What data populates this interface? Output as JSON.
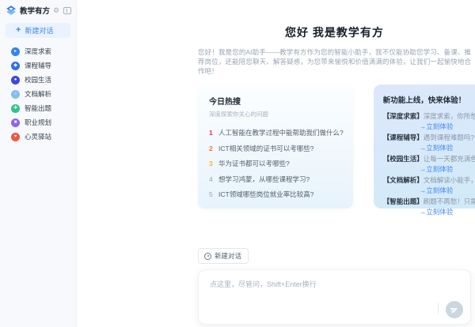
{
  "app": {
    "name": "教学有方"
  },
  "colors": {
    "accent": "#3f87f6",
    "link": "#3d86f5",
    "rank_colors": [
      "#fe2c46",
      "#ff6f2c",
      "#ffb02c",
      "#9aa3af",
      "#9aa3af"
    ],
    "sidebar_icon_colors": [
      "#3583f2",
      "#2f6ef0",
      "#4246d6",
      "#85bdf2",
      "#2ec48b",
      "#8b66f0",
      "#f25540"
    ],
    "hot_card_bg": "#e7f3fb",
    "feature_card_bg": "#d5e9f9",
    "send_button_bg": "#ccd6de"
  },
  "sidebar": {
    "title": "教学有方",
    "logo_icon": "layered-diamond-icon",
    "gear_glyph": "⚙",
    "new_chat": {
      "label": "新建对话",
      "plus": "+"
    },
    "items": [
      {
        "label": "深度求索",
        "icon": "deep-explore-icon",
        "color": "#3583f2",
        "glyph": "▸"
      },
      {
        "label": "课程辅导",
        "icon": "course-tutoring-icon",
        "color": "#2f6ef0",
        "glyph": "◆"
      },
      {
        "label": "校园生活",
        "icon": "campus-life-icon",
        "color": "#4246d6",
        "glyph": "●"
      },
      {
        "label": "文档解析",
        "icon": "doc-analysis-icon",
        "color": "#85bdf2",
        "glyph": "○"
      },
      {
        "label": "智能出题",
        "icon": "quiz-generator-icon",
        "color": "#2ec48b",
        "glyph": "✚"
      },
      {
        "label": "职业规划",
        "icon": "career-planning-icon",
        "color": "#8b66f0",
        "glyph": "■"
      },
      {
        "label": "心灵驿站",
        "icon": "mind-station-icon",
        "color": "#f25540",
        "glyph": "♥"
      }
    ]
  },
  "main": {
    "greeting_title": "您好 我是教学有方",
    "greeting_text": "您好！我是您的AI助手——教学有方作为您的智能小助手，我不仅能协助您学习、备课、推荐岗位，还能陪您聊天、解答疑惑，为您带来愉悦和价值满满的体验，让我们一起愉快地合作吧！",
    "hot_card": {
      "title": "今日热搜",
      "subtitle": "深度探索你关心的问题",
      "items": [
        {
          "rank": "1",
          "text": "人工智能在教学过程中能帮助我们做什么?"
        },
        {
          "rank": "2",
          "text": "ICT相关领域的证书可以考哪些?"
        },
        {
          "rank": "3",
          "text": "华为证书都可以考哪些?"
        },
        {
          "rank": "4",
          "text": "想学习鸿蒙，从哪些课程学习?"
        },
        {
          "rank": "5",
          "text": "ICT领域哪些岗位就业率比较高?"
        }
      ]
    },
    "feature_card": {
      "title": "新功能上线，快来体验！",
      "link_label": "→立刻体验",
      "items": [
        {
          "tag": "【深度求索】",
          "text": "深度求索，你所想要"
        },
        {
          "tag": "【课程辅导】",
          "text": "遇到课程难题吗? 别急，我在..."
        },
        {
          "tag": "【校园生活】",
          "text": "让每一天都充满色彩，让每一..."
        },
        {
          "tag": "【文档解析】",
          "text": "文档解读小能手，每一页都轻..."
        },
        {
          "tag": "【智能出题】",
          "text": "刷题不再愁！只需告诉我您的..."
        }
      ]
    }
  },
  "composer": {
    "new_chat_label": "新建对话",
    "placeholder": "点这里，尽管问，Shift+Enter换行",
    "send_icon": "paper-plane-icon"
  }
}
